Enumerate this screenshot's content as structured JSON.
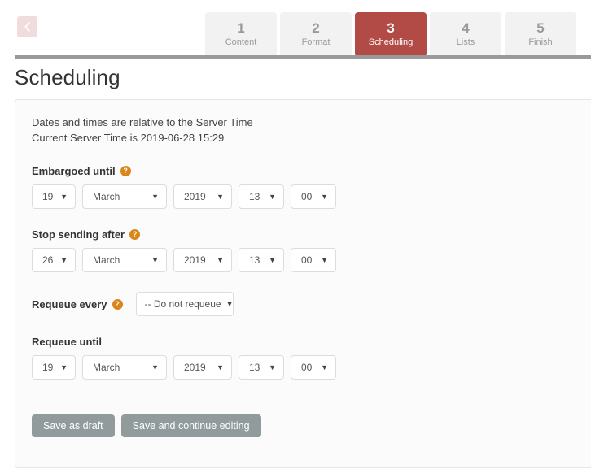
{
  "wizard": {
    "back_button_label": "‹",
    "back_icon": "chevron-left-icon",
    "steps": [
      {
        "number": "1",
        "label": "Content",
        "active": false
      },
      {
        "number": "2",
        "label": "Format",
        "active": false
      },
      {
        "number": "3",
        "label": "Scheduling",
        "active": true
      },
      {
        "number": "4",
        "label": "Lists",
        "active": false
      },
      {
        "number": "5",
        "label": "Finish",
        "active": false
      }
    ],
    "active_color": "#b24a46",
    "inactive_color": "#f2f2f2"
  },
  "page": {
    "title": "Scheduling"
  },
  "card": {
    "notes": {
      "line1": "Dates and times are relative to the Server Time",
      "line2": "Current Server Time is 2019-06-28 15:29"
    },
    "embargoed": {
      "label": "Embargoed until",
      "help_icon": "question-mark-icon",
      "day": "19",
      "month": "March",
      "year": "2019",
      "hour": "13",
      "minute": "00"
    },
    "stop_sending": {
      "label": "Stop sending after",
      "help_icon": "question-mark-icon",
      "day": "26",
      "month": "March",
      "year": "2019",
      "hour": "13",
      "minute": "00"
    },
    "requeue_every": {
      "label": "Requeue every",
      "help_icon": "question-mark-icon",
      "value": "-- Do not requeue"
    },
    "requeue_until": {
      "label": "Requeue until",
      "day": "19",
      "month": "March",
      "year": "2019",
      "hour": "13",
      "minute": "00"
    },
    "buttons": {
      "save_draft": "Save as draft",
      "save_continue": "Save and continue editing"
    }
  },
  "colors": {
    "accent_red": "#b24a46",
    "help_orange": "#d8851a",
    "button_gray": "#919b9c",
    "rule_gray": "#9a9a9a"
  }
}
